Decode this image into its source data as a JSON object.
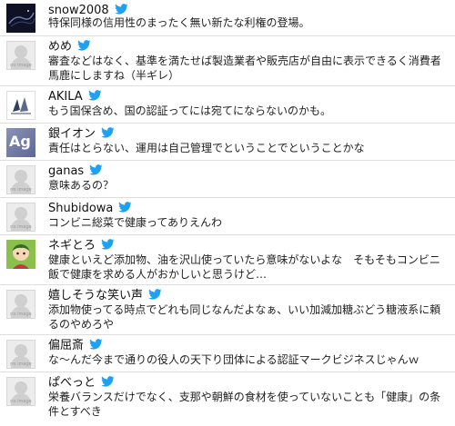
{
  "tweets": [
    {
      "name": "snow2008",
      "text": "特保同様の信用性のまったく無い新たな利権の登場。"
    },
    {
      "name": "めめ",
      "text": "審査などはなく、基準を満たせば製造業者や販売店が自由に表示できるく消費者馬鹿にしますね（半ギレ）"
    },
    {
      "name": "AKILA",
      "text": "もう国保含め、国の認証ってには宛てにならないのかも。"
    },
    {
      "name": "銀イオン",
      "text": "責任はとらない、運用は自己管理でということでということかな",
      "avatar_label": "Ag"
    },
    {
      "name": "ganas",
      "text": "意味あるの？"
    },
    {
      "name": "Shubidowa",
      "text": "コンビニ総菜で健康ってありえんわ"
    },
    {
      "name": "ネギとろ",
      "text": "健康といえど添加物、油を沢山使っていたら意味がないよな　そもそもコンビニ飯で健康を求める人がおかしいと思うけど…"
    },
    {
      "name": "嬉しそうな笑い声",
      "text": "添加物使ってる時点でどれも同じなんだよなぁ、いい加減加糖ぶどう糖液系に頼るのやめろや"
    },
    {
      "name": "偏屈斎",
      "text": "な〜んだ今まで通りの役人の天下り団体による認証マークビジネスじゃんｗ"
    },
    {
      "name": "ぱべっと",
      "text": "栄養バランスだけでなく、支那や朝鮮の食材を使っていないことも「健康」の条件とすべき"
    }
  ],
  "no_image_label": "no image",
  "colors": {
    "twitter_blue": "#1da1f2",
    "avatar_bg": "#ececec"
  },
  "icons": {
    "bird": "twitter-bird-icon"
  }
}
